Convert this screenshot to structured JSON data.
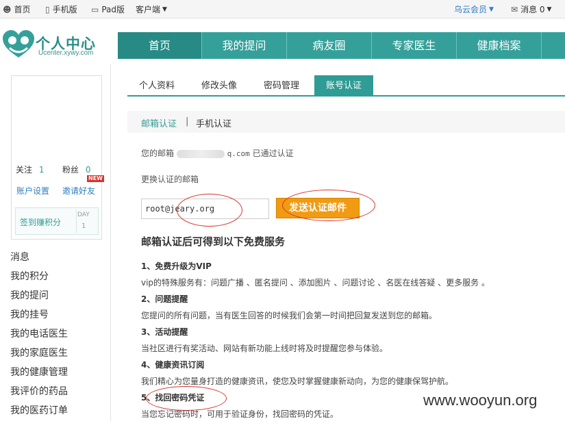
{
  "topbar": {
    "home": "首页",
    "mobile": "手机版",
    "pad": "Pad版",
    "client": "客户端",
    "member": "乌云会员",
    "messages": "消息 0"
  },
  "logo": {
    "title": "个人中心",
    "subtitle": "Ucenter.xywy.com"
  },
  "nav": [
    "首页",
    "我的提问",
    "病友圈",
    "专家医生",
    "健康档案"
  ],
  "profile": {
    "follow_label": "关注",
    "follow_count": "1",
    "fans_label": "粉丝",
    "fans_count": "0",
    "account_settings": "账户设置",
    "invite": "邀请好友",
    "new_badge": "NEW",
    "signin": "签到赚积分",
    "day_label": "DAY",
    "day_count": "1"
  },
  "side_links": [
    "消息",
    "我的积分",
    "我的提问",
    "我的挂号",
    "我的电话医生",
    "我的家庭医生",
    "我的健康管理",
    "我评价的药品",
    "我的医药订单"
  ],
  "tabs": [
    "个人资料",
    "修改头像",
    "密码管理",
    "账号认证"
  ],
  "subtabs": {
    "email": "邮箱认证",
    "sep": "|",
    "phone": "手机认证"
  },
  "verified": {
    "prefix": "您的邮箱",
    "suffix_domain": "q.com",
    "suffix": "已通过认证"
  },
  "change_label": "更换认证的邮箱",
  "email_value": "root@jeary.org",
  "send_button": "发送认证邮件",
  "benefits_heading": "邮箱认证后可得到以下免费服务",
  "benefits": [
    {
      "title": "1、免费升级为VIP",
      "desc": "vip的特殊服务有：问题广播 、匿名提问 、添加图片 、问题讨论 、名医在线答疑 、更多服务 。"
    },
    {
      "title": "2、问题提醒",
      "desc": "您提问的所有问题，当有医生回答的时候我们会第一时间把回复发送到您的邮箱。"
    },
    {
      "title": "3、活动提醒",
      "desc": "当社区进行有奖活动、网站有新功能上线时将及时提醒您参与体验。"
    },
    {
      "title": "4、健康资讯订阅",
      "desc": "我们精心为您量身打造的健康资讯，使您及时掌握健康新动向，为您的健康保驾护航。"
    },
    {
      "title": "5、找回密码凭证",
      "desc": "当您忘记密码时，可用于验证身份，找回密码的凭证。"
    }
  ],
  "watermark": "www.wooyun.org"
}
